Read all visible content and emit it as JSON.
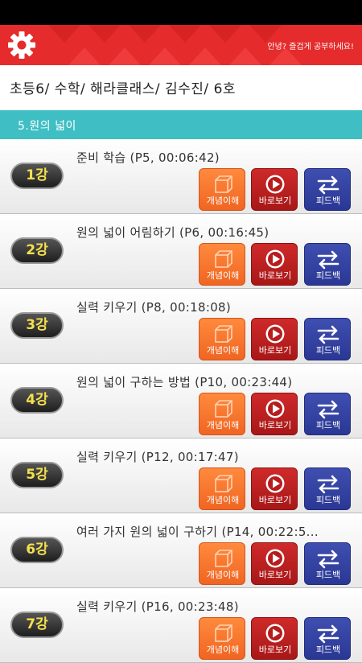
{
  "header": {
    "greeting": "안녕? 즐겁게 공부하세요!",
    "settings_icon": "gear-icon",
    "color": "#e52b2b"
  },
  "breadcrumb": [
    "초등6/",
    "수학/",
    "해라클래스/",
    "김수진/",
    "6호"
  ],
  "section": {
    "title": "5.원의 넓이",
    "color": "#3fbfc4"
  },
  "buttons": {
    "concept": "개념이해",
    "play": "바로보기",
    "feedback": "피드백"
  },
  "lectures": [
    {
      "badge": "1강",
      "title": "준비 학습 (P5, 00:06:42)"
    },
    {
      "badge": "2강",
      "title": "원의 넓이 어림하기 (P6, 00:16:45)"
    },
    {
      "badge": "3강",
      "title": "실력 키우기 (P8, 00:18:08)"
    },
    {
      "badge": "4강",
      "title": "원의 넓이 구하는 방법 (P10, 00:23:44)"
    },
    {
      "badge": "5강",
      "title": "실력 키우기 (P12, 00:17:47)"
    },
    {
      "badge": "6강",
      "title": "여러 가지 원의 넓이 구하기 (P14, 00:22:5..."
    },
    {
      "badge": "7강",
      "title": "실력 키우기 (P16, 00:23:48)"
    }
  ]
}
